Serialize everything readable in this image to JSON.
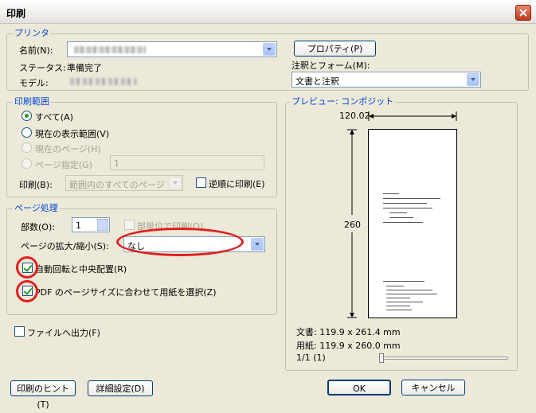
{
  "window": {
    "title": "印刷"
  },
  "printer": {
    "group_label": "プリンタ",
    "name_label": "名前(N):",
    "status_label": "ステータス:",
    "status_value": "準備完了",
    "model_label": "モデル:",
    "properties_button": "プロパティ(P)",
    "notes_forms_label": "注釈とフォーム(M):",
    "notes_forms_value": "文書と注釈"
  },
  "print_range": {
    "group_label": "印刷範囲",
    "options": [
      {
        "label": "すべて(A)",
        "selected": true,
        "enabled": true
      },
      {
        "label": "現在の表示範囲(V)",
        "selected": false,
        "enabled": true
      },
      {
        "label": "現在のページ(H)",
        "selected": false,
        "enabled": false
      },
      {
        "label": "ページ指定(G)",
        "selected": false,
        "enabled": false
      }
    ],
    "pages_value": "1",
    "print_label": "印刷(B):",
    "print_value": "範囲内のすべてのページ",
    "reverse_label": "逆順に印刷(E)"
  },
  "page_handling": {
    "group_label": "ページ処理",
    "copies_label": "部数(O):",
    "copies_value": "1",
    "collate_label": "部単位で印刷(O)",
    "scaling_label": "ページの拡大/縮小(S):",
    "scaling_value": "なし",
    "auto_rotate_label": "自動回転と中央配置(R)",
    "pdf_size_label": "PDF のページサイズに合わせて用紙を選択(Z)"
  },
  "print_to_file_label": "ファイルへ出力(F)",
  "preview": {
    "group_label": "プレビュー: コンポジット",
    "width_value": "120.02",
    "height_value": "260",
    "document_size": "文書: 119.9 x 261.4 mm",
    "paper_size": "用紙: 119.9 x 260.0 mm",
    "page_counter": "1/1 (1)",
    "slider_position": 0
  },
  "footer": {
    "hints_button": "印刷のヒント(T)",
    "advanced_button": "詳細設定(D)",
    "ok_button": "OK",
    "cancel_button": "キャンセル"
  },
  "colors": {
    "dialog_bg": "#ece9d8",
    "legend_text": "#0046d5",
    "highlight_red": "#e02020",
    "check_green": "#21a121"
  }
}
